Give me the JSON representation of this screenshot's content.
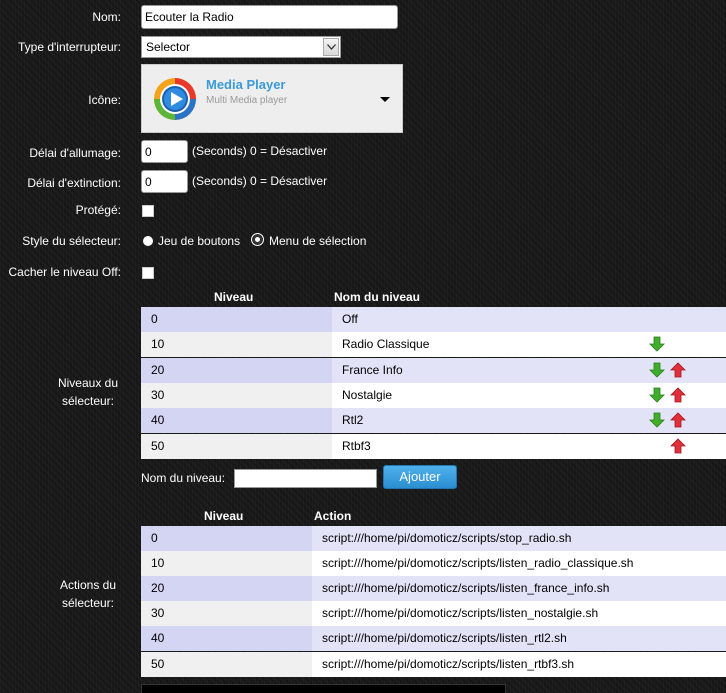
{
  "form": {
    "name_label": "Nom:",
    "name_value": "Ecouter la Radio",
    "switch_type_label": "Type d'interrupteur:",
    "switch_type_value": "Selector",
    "icon_label": "Icône:",
    "icon_title": "Media Player",
    "icon_subtitle": "Multi Media player",
    "on_delay_label": "Délai d'allumage:",
    "on_delay_value": "0",
    "on_delay_hint": "(Seconds) 0 = Désactiver",
    "off_delay_label": "Délai d'extinction:",
    "off_delay_value": "0",
    "off_delay_hint": "(Seconds) 0 = Désactiver",
    "protected_label": "Protégé:",
    "selector_style_label": "Style du sélecteur:",
    "style_option_buttons": "Jeu de boutons",
    "style_option_menu": "Menu de sélection",
    "selected_style": "buttons",
    "hide_off_label": "Cacher le niveau Off:",
    "levels_label": "Niveaux du sélecteur:",
    "new_level_label": "Nom du niveau:",
    "new_level_value": "",
    "add_button": "Ajouter",
    "actions_label": "Actions du sélecteur:"
  },
  "levels_table": {
    "headers": [
      "Niveau",
      "Nom du niveau"
    ],
    "rows": [
      {
        "level": "0",
        "name": "Off",
        "down": false,
        "up": false
      },
      {
        "level": "10",
        "name": "Radio Classique",
        "down": true,
        "up": false
      },
      {
        "level": "20",
        "name": "France Info",
        "down": true,
        "up": true
      },
      {
        "level": "30",
        "name": "Nostalgie",
        "down": true,
        "up": true
      },
      {
        "level": "40",
        "name": "Rtl2",
        "down": true,
        "up": true
      },
      {
        "level": "50",
        "name": "Rtbf3",
        "down": false,
        "up": true
      }
    ]
  },
  "actions_table": {
    "headers": [
      "Niveau",
      "Action"
    ],
    "rows": [
      {
        "level": "0",
        "action": "script:///home/pi/domoticz/scripts/stop_radio.sh"
      },
      {
        "level": "10",
        "action": "script:///home/pi/domoticz/scripts/listen_radio_classique.sh"
      },
      {
        "level": "20",
        "action": "script:///home/pi/domoticz/scripts/listen_france_info.sh"
      },
      {
        "level": "30",
        "action": "script:///home/pi/domoticz/scripts/listen_nostalgie.sh"
      },
      {
        "level": "40",
        "action": "script:///home/pi/domoticz/scripts/listen_rtl2.sh"
      },
      {
        "level": "50",
        "action": "script:///home/pi/domoticz/scripts/listen_rtbf3.sh"
      }
    ]
  },
  "colors": {
    "accent_button": "#2a8ed0",
    "icon_title": "#3a9bd8",
    "row_odd": "#e3e3f8",
    "row_even": "#ffffff",
    "arrow_down": "#3fae2a",
    "arrow_up": "#e0303a"
  }
}
